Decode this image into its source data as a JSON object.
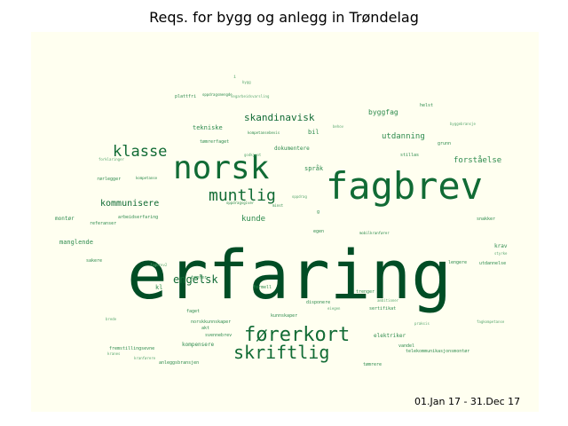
{
  "title": "Reqs. for bygg og anlegg in Trøndelag",
  "date_range": "01.Jan 17 - 31.Dec 17",
  "colors": {
    "background": "#fffff0",
    "dark": "#004d25",
    "mid": "#116b35",
    "light": "#2e8b4e",
    "faint": "#5aa870"
  },
  "chart_data": {
    "type": "wordcloud",
    "title": "Reqs. for bygg og anlegg in Trøndelag",
    "words": [
      {
        "text": "erfaring",
        "weight": 100
      },
      {
        "text": "fagbrev",
        "weight": 42
      },
      {
        "text": "norsk",
        "weight": 36
      },
      {
        "text": "førerkort",
        "weight": 22
      },
      {
        "text": "skriftlig",
        "weight": 20
      },
      {
        "text": "muntlig",
        "weight": 17
      },
      {
        "text": "klasse",
        "weight": 16
      },
      {
        "text": "engelsk",
        "weight": 10
      },
      {
        "text": "skandinavisk",
        "weight": 9
      },
      {
        "text": "kommunisere",
        "weight": 8
      },
      {
        "text": "utdanning",
        "weight": 7
      },
      {
        "text": "forståelse",
        "weight": 7
      },
      {
        "text": "byggfag",
        "weight": 6
      },
      {
        "text": "kunde",
        "weight": 6
      },
      {
        "text": "tekniske",
        "weight": 6
      },
      {
        "text": "dokumentere",
        "weight": 5
      },
      {
        "text": "språk",
        "weight": 5
      },
      {
        "text": "bil",
        "weight": 5
      },
      {
        "text": "kl",
        "weight": 5
      },
      {
        "text": "manglende",
        "weight": 5
      },
      {
        "text": "montør",
        "weight": 5
      },
      {
        "text": "krav",
        "weight": 5
      },
      {
        "text": "kompensere",
        "weight": 4
      },
      {
        "text": "elektriker",
        "weight": 4
      },
      {
        "text": "fremstillingsevne",
        "weight": 4
      },
      {
        "text": "rørlegger",
        "weight": 4
      },
      {
        "text": "referanser",
        "weight": 4
      },
      {
        "text": "arbeidserfaring",
        "weight": 4
      },
      {
        "text": "tømrer",
        "weight": 4
      },
      {
        "text": "tømrerfaget",
        "weight": 4
      },
      {
        "text": "plattfri",
        "weight": 4
      },
      {
        "text": "oppdragsmengde",
        "weight": 3
      },
      {
        "text": "kompetansebevis",
        "weight": 3
      },
      {
        "text": "grunn",
        "weight": 4
      },
      {
        "text": "stillas",
        "weight": 3
      },
      {
        "text": "egen",
        "weight": 3
      },
      {
        "text": "mobilkranfører",
        "weight": 3
      },
      {
        "text": "lengere",
        "weight": 3
      },
      {
        "text": "utdannelse",
        "weight": 3
      },
      {
        "text": "snakker",
        "weight": 3
      },
      {
        "text": "g",
        "weight": 3
      },
      {
        "text": "formell",
        "weight": 3
      },
      {
        "text": "trenger",
        "weight": 3
      },
      {
        "text": "disponere",
        "weight": 3
      },
      {
        "text": "sertifikat",
        "weight": 3
      },
      {
        "text": "faget",
        "weight": 3
      },
      {
        "text": "norskkunnskaper",
        "weight": 3
      },
      {
        "text": "kunnskaper",
        "weight": 3
      },
      {
        "text": "svennebrev",
        "weight": 3
      },
      {
        "text": "akt",
        "weight": 3
      },
      {
        "text": "anleggsbransjen",
        "weight": 3
      },
      {
        "text": "telekommunikasjonsmontør",
        "weight": 3
      },
      {
        "text": "vandel",
        "weight": 3
      },
      {
        "text": "tømrere",
        "weight": 3
      },
      {
        "text": "sakere",
        "weight": 3
      },
      {
        "text": "helst",
        "weight": 3
      },
      {
        "text": "kompetanse",
        "weight": 3
      },
      {
        "text": "oppdragsgiver",
        "weight": 3
      },
      {
        "text": "minst",
        "weight": 3
      },
      {
        "text": "i",
        "weight": 2
      },
      {
        "text": "bygg",
        "weight": 2
      },
      {
        "text": "vegarbeidsvarsling",
        "weight": 2
      },
      {
        "text": "behov",
        "weight": 2
      },
      {
        "text": "godkjent",
        "weight": 2
      },
      {
        "text": "styrke",
        "weight": 2
      },
      {
        "text": "byggebransje",
        "weight": 2
      },
      {
        "text": "ambitioner",
        "weight": 2
      },
      {
        "text": "praksis",
        "weight": 2
      },
      {
        "text": "fagkompetanse",
        "weight": 2
      },
      {
        "text": "eiegen",
        "weight": 2
      },
      {
        "text": "brede",
        "weight": 2
      },
      {
        "text": "kranes",
        "weight": 2
      },
      {
        "text": "kranførere",
        "weight": 2
      },
      {
        "text": "forklaringer",
        "weight": 2
      },
      {
        "text": "fagbrev2",
        "weight": 2
      },
      {
        "text": "oppdrag",
        "weight": 2
      }
    ]
  }
}
